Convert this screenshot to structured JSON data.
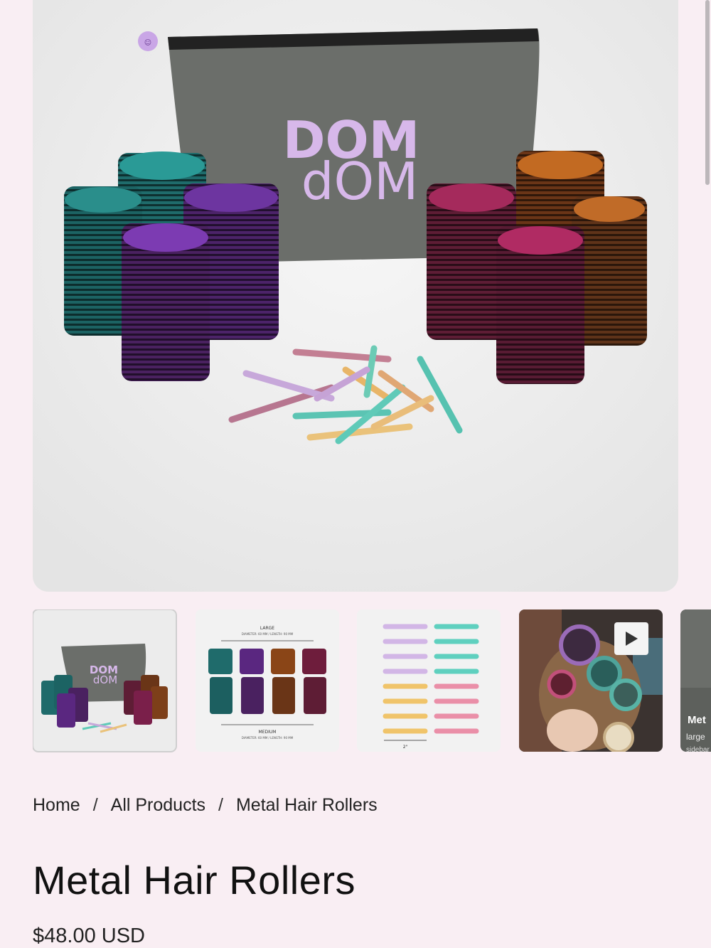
{
  "product": {
    "brand_mark_line1": "DOM",
    "brand_mark_line2": "dOM",
    "title": "Metal Hair Rollers",
    "price": "$48.00 USD"
  },
  "breadcrumb": {
    "items": [
      "Home",
      "All Products",
      "Metal Hair Rollers"
    ],
    "separator": "/"
  },
  "thumbnails": {
    "sizes_top_label": "LARGE",
    "sizes_top_dims": "DIAMETER: 60 MM  /  LENGTH: 90 MM",
    "sizes_bottom_label": "MEDIUM",
    "sizes_bottom_dims": "DIAMETER: 60 MM  /  LENGTH: 90 MM",
    "clips_label": "2\"",
    "partial_title": "Met",
    "partial_sub": "large",
    "partial_sub2": "sidebar"
  },
  "colors": {
    "page_bg": "#f9eef3",
    "brand_lavender": "#d7b8ea",
    "bag_gray": "#6b6e6a"
  }
}
